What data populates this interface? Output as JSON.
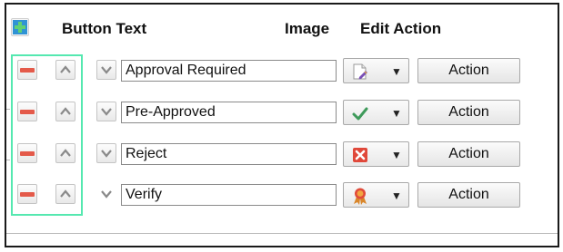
{
  "header": {
    "button_text": "Button Text",
    "image": "Image",
    "edit_action": "Edit Action"
  },
  "colors": {
    "remove": "#e45a4a",
    "add": "#3aa0d6",
    "highlight": "#55e8b0"
  },
  "rows": [
    {
      "text": "Approval Required",
      "image_icon": "document-pencil-icon",
      "action_label": "Action"
    },
    {
      "text": "Pre-Approved",
      "image_icon": "checkmark-icon",
      "action_label": "Action"
    },
    {
      "text": "Reject",
      "image_icon": "red-x-icon",
      "action_label": "Action"
    },
    {
      "text": "Verify",
      "image_icon": "ribbon-award-icon",
      "action_label": "Action"
    }
  ],
  "dropdown_caret": "▼"
}
